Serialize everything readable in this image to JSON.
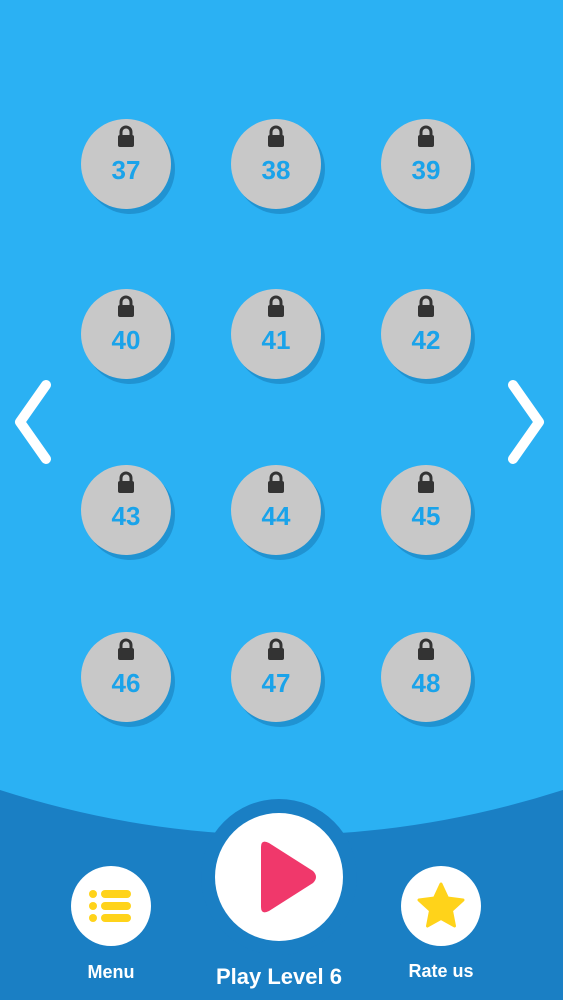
{
  "colors": {
    "background": "#2bb1f3",
    "bottom_panel": "#1a7fc4",
    "locked_level": "#c8c8c8",
    "level_number": "#1aa3ea",
    "lock": "#333333",
    "play_triangle": "#f0386b",
    "accent_yellow": "#ffd31a"
  },
  "levels": [
    {
      "number": "37",
      "locked": true,
      "icon": "lock-icon"
    },
    {
      "number": "38",
      "locked": true,
      "icon": "lock-icon"
    },
    {
      "number": "39",
      "locked": true,
      "icon": "lock-icon"
    },
    {
      "number": "40",
      "locked": true,
      "icon": "lock-icon"
    },
    {
      "number": "41",
      "locked": true,
      "icon": "lock-icon"
    },
    {
      "number": "42",
      "locked": true,
      "icon": "lock-icon"
    },
    {
      "number": "43",
      "locked": true,
      "icon": "lock-icon"
    },
    {
      "number": "44",
      "locked": true,
      "icon": "lock-icon"
    },
    {
      "number": "45",
      "locked": true,
      "icon": "lock-icon"
    },
    {
      "number": "46",
      "locked": true,
      "icon": "lock-icon"
    },
    {
      "number": "47",
      "locked": true,
      "icon": "lock-icon"
    },
    {
      "number": "48",
      "locked": true,
      "icon": "lock-icon"
    }
  ],
  "navigation": {
    "prev_icon": "chevron-left-icon",
    "next_icon": "chevron-right-icon"
  },
  "bottom_bar": {
    "menu_label": "Menu",
    "menu_icon": "list-icon",
    "play_label": "Play Level 6",
    "play_icon": "play-icon",
    "rate_label": "Rate us",
    "rate_icon": "star-icon"
  }
}
